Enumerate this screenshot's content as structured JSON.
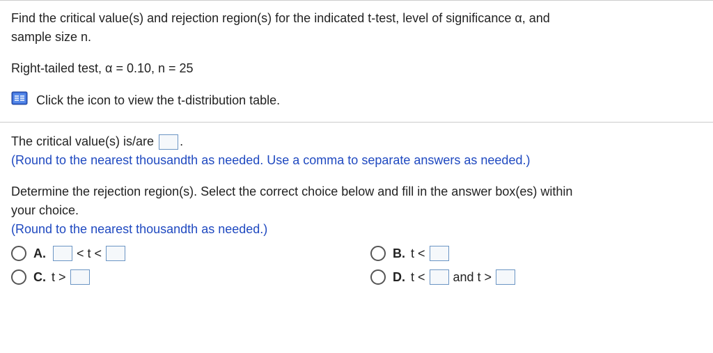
{
  "problem": {
    "intro_line1": "Find the critical value(s) and rejection region(s) for the indicated t-test, level of significance α, and",
    "intro_line2": "sample size n.",
    "params": "Right-tailed test, α = 0.10, n = 25",
    "link_text": "Click the icon to view the t-distribution table."
  },
  "part1": {
    "prompt_prefix": "The critical value(s) is/are ",
    "prompt_suffix": ".",
    "instruction": "(Round to the nearest thousandth as needed. Use a comma to separate answers as needed.)"
  },
  "part2": {
    "prompt_line1": "Determine the rejection region(s). Select the correct choice below and fill in the answer box(es) within",
    "prompt_line2": "your choice.",
    "instruction": "(Round to the nearest thousandth as needed.)"
  },
  "choices": {
    "A": {
      "label": "A.",
      "seg1": "< t <"
    },
    "B": {
      "label": "B.",
      "seg1": "t <"
    },
    "C": {
      "label": "C.",
      "seg1": "t >"
    },
    "D": {
      "label": "D.",
      "seg1": "t <",
      "seg2": "and t >"
    }
  }
}
